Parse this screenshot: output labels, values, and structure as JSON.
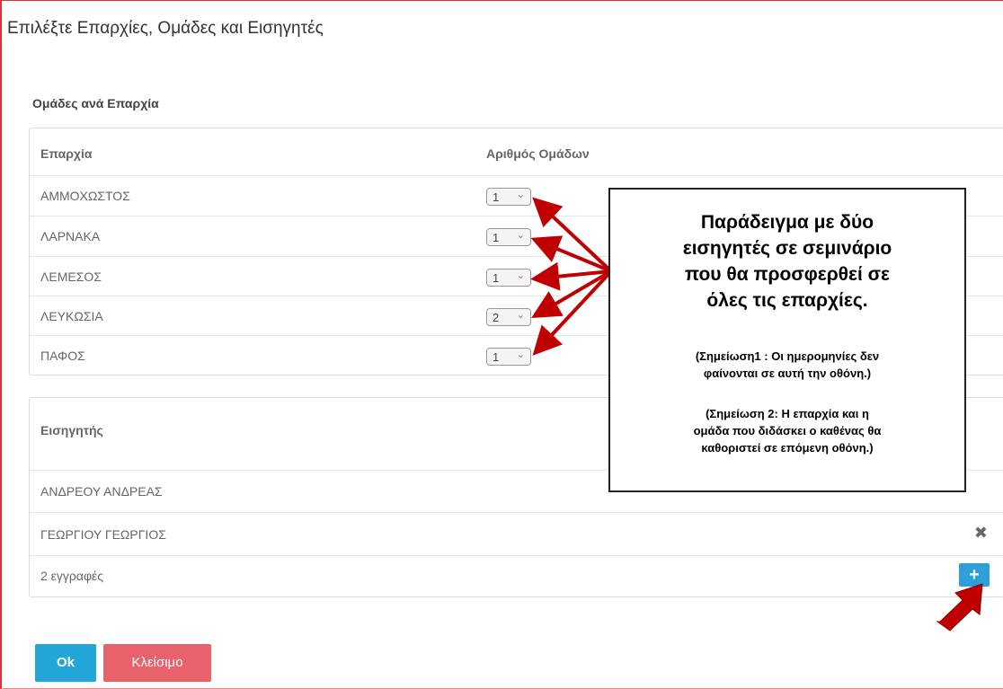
{
  "dialog": {
    "title": "Επιλέξτε Επαρχίες, Ομάδες και Εισηγητές"
  },
  "provinces": {
    "heading": "Ομάδες ανά Επαρχία",
    "columns": [
      "Επαρχία",
      "Αριθμός Ομάδων"
    ],
    "rows": [
      {
        "name": "ΑΜΜΟΧΩΣΤΟΣ",
        "groups": "1"
      },
      {
        "name": "ΛΑΡΝΑΚΑ",
        "groups": "1"
      },
      {
        "name": "ΛΕΜΕΣΟΣ",
        "groups": "1"
      },
      {
        "name": "ΛΕΥΚΩΣΙΑ",
        "groups": "2"
      },
      {
        "name": "ΠΑΦΟΣ",
        "groups": "1"
      }
    ]
  },
  "speakers": {
    "column": "Εισηγητής",
    "rows": [
      {
        "name": "ΑΝΔΡΕΟΥ ΑΝΔΡΕΑΣ"
      },
      {
        "name": "ΓΕΩΡΓΙΟΥ ΓΕΩΡΓΙΟΣ"
      }
    ],
    "record_count": "2 εγγραφές",
    "remove_icon": "✖",
    "add_icon": "+"
  },
  "buttons": {
    "ok": "Ok",
    "close": "Κλείσιμο"
  },
  "callout": {
    "line1": "Παράδειγμα με δύο",
    "line2": "εισηγητές σε σεμινάριο",
    "line3": "που θα προσφερθεί σε",
    "line4": "όλες τις επαρχίες.",
    "note1_line1": "(Σημείωση1 : Οι ημερομηνίες δεν",
    "note1_line2": "φαίνονται σε αυτή την οθόνη.)",
    "note2_line1": "(Σημείωση 2: Η επαρχία και η",
    "note2_line2": "ομάδα που διδάσκει ο καθένας θα",
    "note2_line3": "καθοριστεί σε επόμενη οθόνη.)"
  },
  "colors": {
    "primary": "#22a6d8",
    "danger": "#e8626b",
    "annotation_arrow": "#c00000"
  }
}
